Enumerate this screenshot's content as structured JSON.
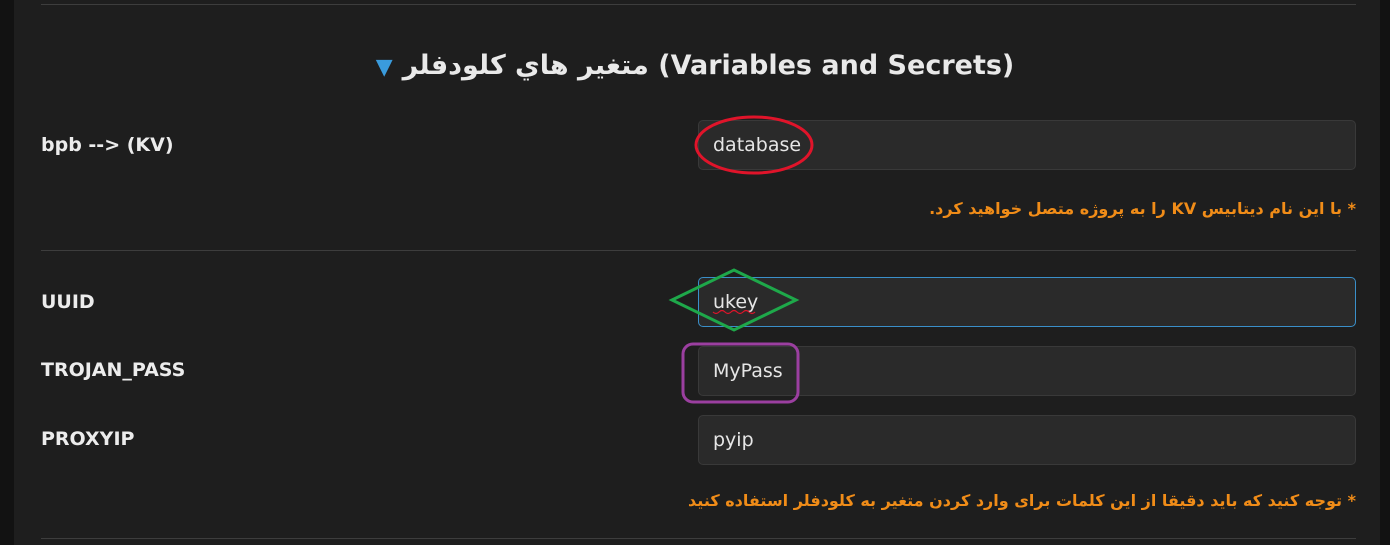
{
  "section": {
    "title": "متغير هاي كلودفلر (Variables and Secrets)",
    "toggle_icon": "triangle-down-icon",
    "accent_color": "#3a9bdc"
  },
  "kv": {
    "label": "bpb --> (KV)",
    "value": "database",
    "note": "* با این نام دیتابیس KV را به پروژه متصل خواهید کرد."
  },
  "vars": {
    "uuid_label": "UUID",
    "uuid_value": "ukey",
    "trojan_label": "TROJAN_PASS",
    "trojan_value": "MyPass",
    "proxyip_label": "PROXYIP",
    "proxyip_value": "pyip",
    "note": "* توجه کنید که باید دقیقا از این کلمات برای وارد کردن متغیر به کلودفلر استفاده کنید"
  },
  "annotations": {
    "red_ellipse_color": "#e0142a",
    "green_diamond_color": "#1ea84a",
    "purple_box_color": "#9b3fa0"
  },
  "note_color": "#f08c18"
}
